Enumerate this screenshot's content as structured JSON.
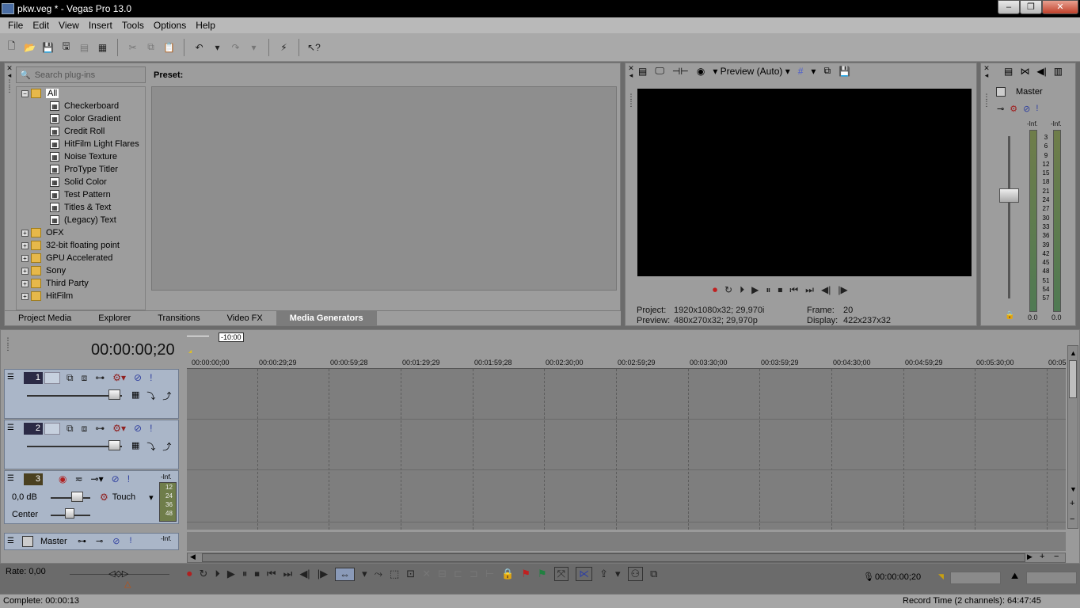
{
  "window": {
    "title": "pkw.veg * - Vegas Pro 13.0",
    "min": "‒",
    "max": "❐",
    "close": "✕"
  },
  "menu": [
    "File",
    "Edit",
    "View",
    "Insert",
    "Tools",
    "Options",
    "Help"
  ],
  "plugins": {
    "search_placeholder": "Search plug-ins",
    "preset_label": "Preset:",
    "root": "All",
    "generators": [
      "Checkerboard",
      "Color Gradient",
      "Credit Roll",
      "HitFilm Light Flares",
      "Noise Texture",
      "ProType Titler",
      "Solid Color",
      "Test Pattern",
      "Titles & Text",
      "(Legacy) Text"
    ],
    "folders": [
      "OFX",
      "32-bit floating point",
      "GPU Accelerated",
      "Sony",
      "Third Party",
      "HitFilm"
    ]
  },
  "tabs": [
    "Project Media",
    "Explorer",
    "Transitions",
    "Video FX",
    "Media Generators"
  ],
  "active_tab": "Media Generators",
  "preview": {
    "mode": "Preview (Auto)",
    "project_label": "Project:",
    "project_value": "1920x1080x32; 29,970i",
    "preview_label": "Preview:",
    "preview_value": "480x270x32; 29,970p",
    "frame_label": "Frame:",
    "frame_value": "20",
    "display_label": "Display:",
    "display_value": "422x237x32"
  },
  "master_mixer": {
    "title": "Master",
    "inf_left": "-Inf.",
    "inf_right": "-Inf.",
    "scale": [
      "3",
      "6",
      "9",
      "12",
      "15",
      "18",
      "21",
      "24",
      "27",
      "30",
      "33",
      "36",
      "39",
      "42",
      "45",
      "48",
      "51",
      "54",
      "57"
    ],
    "bottom_left": "0.0",
    "bottom_right": "0.0"
  },
  "timeline": {
    "current_time": "00:00:00;20",
    "marker": "-10:00",
    "ruler": [
      "00:00:00;00",
      "00:00:29;29",
      "00:00:59;28",
      "00:01:29;29",
      "00:01:59;28",
      "00:02:30;00",
      "00:02:59;29",
      "00:03:30;00",
      "00:03:59;29",
      "00:04:30;00",
      "00:04:59;29",
      "00:05:30;00",
      "00:05"
    ],
    "tracks": [
      {
        "num": "1",
        "kind": "video"
      },
      {
        "num": "2",
        "kind": "video"
      },
      {
        "num": "3",
        "kind": "audio",
        "volume": "0,0 dB",
        "pan": "Center",
        "automation": "Touch",
        "meter_top": "-Inf.",
        "meter_scale": [
          "12",
          "24",
          "36",
          "48"
        ]
      }
    ],
    "master": {
      "label": "Master",
      "inf": "-Inf."
    }
  },
  "transport": {
    "rate": "Rate: 0,00",
    "cursor_time": "00:00:00;20"
  },
  "status": {
    "left": "Complete: 00:00:13",
    "right": "Record Time (2 channels): 64:47:45"
  }
}
